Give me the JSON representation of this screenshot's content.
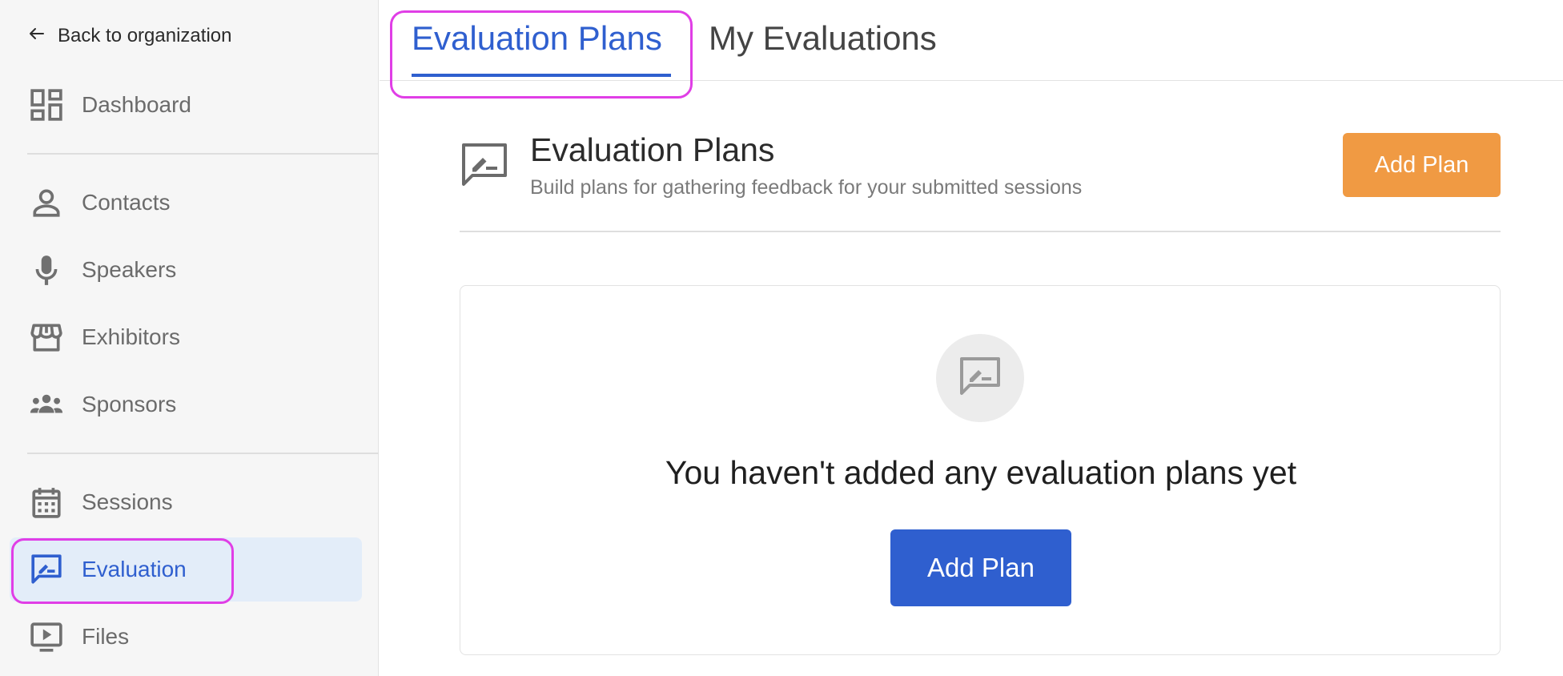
{
  "sidebar": {
    "back_label": "Back to organization",
    "items": [
      {
        "label": "Dashboard",
        "icon": "dashboard-icon"
      },
      {
        "label": "Contacts",
        "icon": "person-icon"
      },
      {
        "label": "Speakers",
        "icon": "microphone-icon"
      },
      {
        "label": "Exhibitors",
        "icon": "storefront-icon"
      },
      {
        "label": "Sponsors",
        "icon": "group-icon"
      },
      {
        "label": "Sessions",
        "icon": "calendar-icon"
      },
      {
        "label": "Evaluation",
        "icon": "feedback-icon",
        "active": true
      },
      {
        "label": "Files",
        "icon": "play-video-icon"
      }
    ]
  },
  "tabs": [
    {
      "label": "Evaluation Plans",
      "active": true
    },
    {
      "label": "My Evaluations",
      "active": false
    }
  ],
  "header": {
    "title": "Evaluation Plans",
    "subtitle": "Build plans for gathering feedback for your submitted sessions",
    "add_button": "Add Plan"
  },
  "empty_state": {
    "message": "You haven't added any evaluation plans yet",
    "add_button": "Add Plan"
  },
  "colors": {
    "accent_blue": "#2f5fcf",
    "orange_button": "#f09a43",
    "highlight_magenta": "#e03ee6",
    "active_nav_bg": "#e3edf9"
  }
}
